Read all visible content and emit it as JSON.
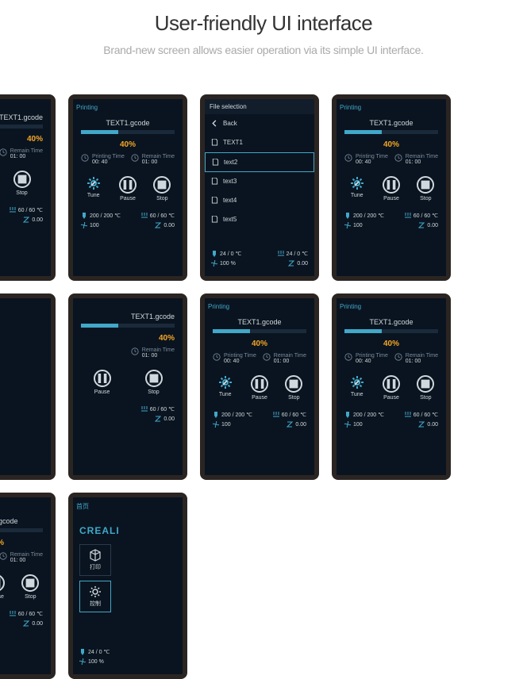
{
  "page_title": "User-friendly UI interface",
  "page_subtitle": "Brand-new screen allows easier operation via its simple UI interface.",
  "printing": {
    "head": "Printing",
    "file": "TEXT1.gcode",
    "pct": "40%",
    "pct_val": 40,
    "print_time_label": "Printing Time",
    "print_time": "00: 40",
    "remain_time_label": "Remain Time",
    "remain_time": "01: 00",
    "tune": "Tune",
    "pause": "Pause",
    "stop": "Stop",
    "nozzle": "200 / 200 ℃",
    "bed": "60 / 60 ℃",
    "fan": "100",
    "z": "0.00"
  },
  "files": {
    "head": "File selection",
    "back": "Back",
    "items": [
      "TEXT1",
      "text2",
      "text3",
      "text4",
      "text5"
    ],
    "nozzle": "24 / 0 ℃",
    "bed": "24 / 0 ℃",
    "fan": "100 %",
    "z": "0.00"
  },
  "home": {
    "head": "首页",
    "brand": "CREALI",
    "print": "打印",
    "control": "控制",
    "print_alt": "打印",
    "ctrl_alt": "控制",
    "nozzle": "24 / 0 ℃",
    "fan": "100 %"
  }
}
